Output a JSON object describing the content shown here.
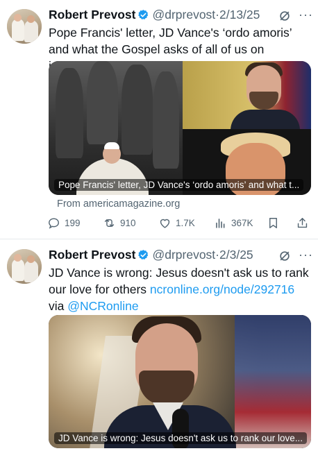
{
  "tweets": [
    {
      "author_name": "Robert Prevost",
      "handle": "@drprevost",
      "separator": "·",
      "date": "2/13/25",
      "text": "Pope Francis' letter, JD Vance's ‘ordo amoris’ and what the Gospel asks of all of us on immigration",
      "card_caption": "Pope Francis' letter, JD Vance's ‘ordo amoris’ and what t...",
      "card_source": "From americamagazine.org",
      "stats": {
        "replies": "199",
        "reposts": "910",
        "likes": "1.7K",
        "views": "367K"
      }
    },
    {
      "author_name": "Robert Prevost",
      "handle": "@drprevost",
      "separator": "·",
      "date": "2/3/25",
      "text_plain": "JD Vance is wrong: Jesus doesn't ask us to rank our love for others",
      "text_link": "ncronline.org/node/292716",
      "text_via": "via",
      "text_mention": "@NCRonline",
      "card_caption": "JD Vance is wrong: Jesus doesn't ask us to rank our love..."
    }
  ],
  "colors": {
    "link": "#1d9bf0",
    "secondary": "#536471",
    "verified": "#1d9bf0"
  },
  "icons": [
    "verified-badge-icon",
    "grok-icon",
    "more-icon",
    "reply-icon",
    "repost-icon",
    "like-icon",
    "views-icon",
    "bookmark-icon",
    "share-icon"
  ]
}
